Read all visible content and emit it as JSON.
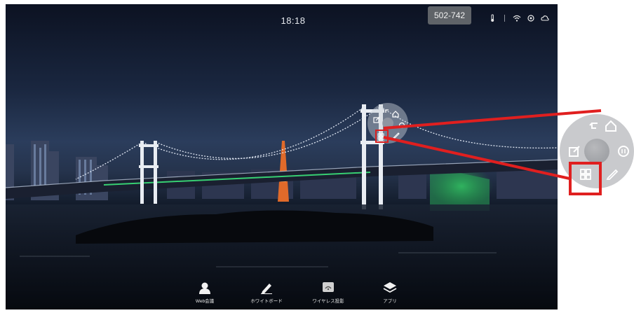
{
  "status_bar": {
    "time": "18:18",
    "room_code": "502-742",
    "icons": [
      "thermometer-icon",
      "wifi-icon",
      "sync-icon",
      "cloud-icon"
    ]
  },
  "floating_menu": {
    "buttons": [
      "undo-icon",
      "home-icon",
      "annotate-icon",
      "circle-icon",
      "apps-grid-icon",
      "pen-icon"
    ],
    "highlighted": "apps-grid-icon"
  },
  "dock": {
    "items": [
      {
        "label": "Web会議",
        "icon": "person-icon"
      },
      {
        "label": "ホワイトボード",
        "icon": "pencil-icon"
      },
      {
        "label": "ワイヤレス投影",
        "icon": "wireless-cast-icon"
      },
      {
        "label": "アプリ",
        "icon": "layers-icon"
      }
    ]
  },
  "colors": {
    "highlight": "#e01f1f",
    "callout_line": "#e01f1f",
    "menu_bg": "#c9cacd"
  }
}
